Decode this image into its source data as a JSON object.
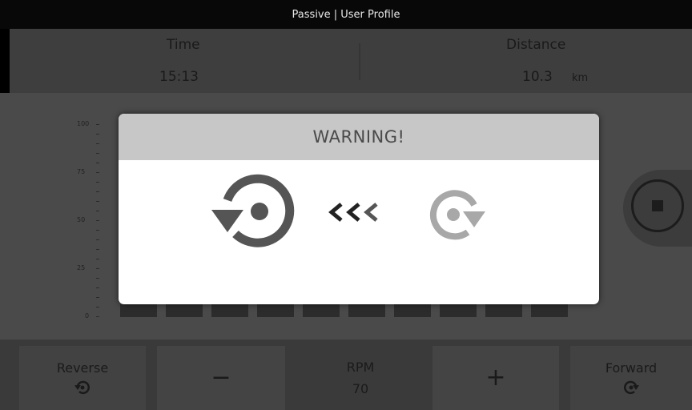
{
  "title_bar": {
    "text": "Passive | User Profile"
  },
  "stats": {
    "time": {
      "label": "Time",
      "value": "15:13"
    },
    "distance": {
      "label": "Distance",
      "value": "10.3",
      "unit": "km"
    }
  },
  "chart": {
    "y_ticks": [
      "100",
      "75",
      "50",
      "25",
      "0"
    ]
  },
  "warning": {
    "title": "WARNING!"
  },
  "controls": {
    "reverse": {
      "label": "Reverse"
    },
    "minus": {
      "label": "−"
    },
    "rpm": {
      "label": "RPM",
      "value": "70"
    },
    "plus": {
      "label": "+"
    },
    "forward": {
      "label": "Forward"
    }
  },
  "icons": {
    "reverse": "rotate-ccw-icon",
    "forward": "rotate-cw-icon",
    "chevrons": "chevrons-left-icon",
    "stop": "stop-icon"
  },
  "colors": {
    "modal_header": "#c7c7c7",
    "icon_dark": "#555555",
    "icon_light": "#a8a8a8"
  }
}
